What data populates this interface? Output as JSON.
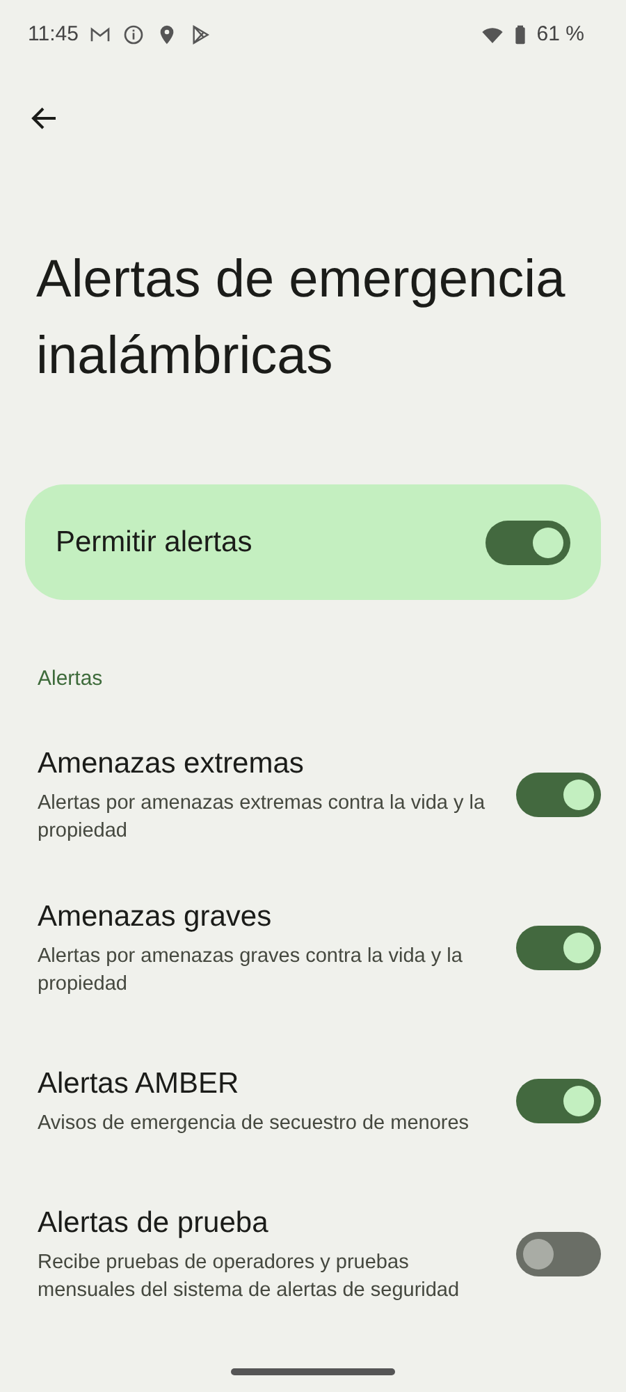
{
  "status_bar": {
    "time": "11:45",
    "battery": "61 %"
  },
  "page": {
    "title": "Alertas de emergencia inalámbricas"
  },
  "master": {
    "label": "Permitir alertas",
    "on": true
  },
  "section": {
    "header": "Alertas"
  },
  "items": [
    {
      "title": "Amenazas extremas",
      "summary": "Alertas por amenazas extremas contra la vida y la propiedad",
      "on": true
    },
    {
      "title": "Amenazas graves",
      "summary": "Alertas por amenazas graves contra la vida y la propiedad",
      "on": true
    },
    {
      "title": "Alertas AMBER",
      "summary": "Avisos de emergencia de secuestro de menores",
      "on": true
    },
    {
      "title": "Alertas de prueba",
      "summary": "Recibe pruebas de operadores y pruebas mensuales del sistema de alertas de seguridad",
      "on": false
    }
  ]
}
